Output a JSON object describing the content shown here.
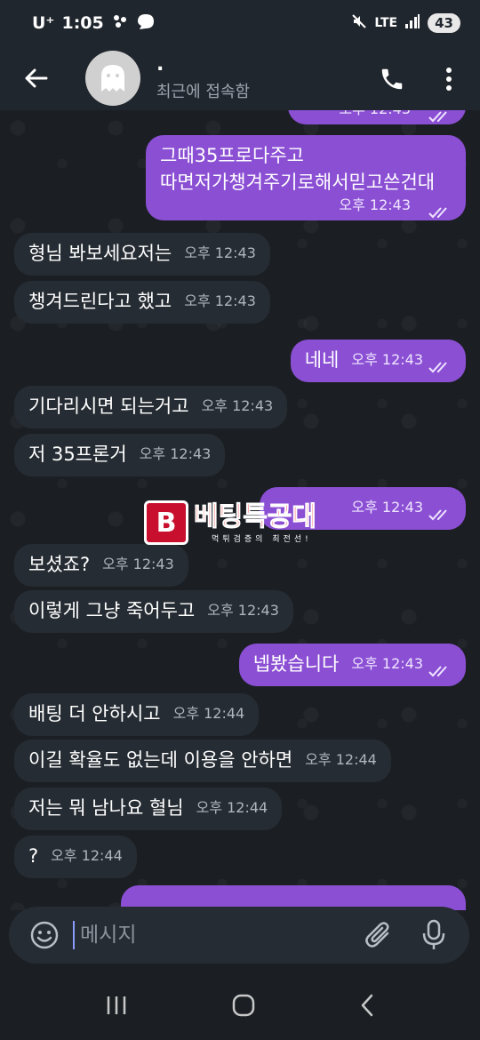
{
  "status_bar": {
    "carrier": "U⁺",
    "time": "1:05",
    "network": "LTE",
    "battery": "43"
  },
  "header": {
    "contact_name": ".",
    "contact_status": "최근에 접속함"
  },
  "messages": [
    {
      "dir": "out",
      "text": "",
      "time": "오후 12:43"
    },
    {
      "dir": "out",
      "text": "그때35프로다주고\n따면저가챙겨주기로해서믿고쓴건대",
      "time": "오후 12:43"
    },
    {
      "dir": "in",
      "text": "형님 봐보세요저는",
      "time": "오후 12:43"
    },
    {
      "dir": "in",
      "text": "챙겨드린다고 했고",
      "time": "오후 12:43"
    },
    {
      "dir": "out",
      "text": "네네",
      "time": "오후 12:43"
    },
    {
      "dir": "in",
      "text": "기다리시면 되는거고",
      "time": "오후 12:43"
    },
    {
      "dir": "in",
      "text": "저 35프론거",
      "time": "오후 12:43"
    },
    {
      "dir": "out",
      "text": "",
      "time": "오후 12:43"
    },
    {
      "dir": "in",
      "text": "보셨죠?",
      "time": "오후 12:43"
    },
    {
      "dir": "in",
      "text": "이렇게 그냥 죽어두고",
      "time": "오후 12:43"
    },
    {
      "dir": "out",
      "text": "넵봤습니다",
      "time": "오후 12:43"
    },
    {
      "dir": "in",
      "text": "배팅 더 안하시고",
      "time": "오후 12:44"
    },
    {
      "dir": "in",
      "text": "이길 확율도 없는데 이용을 안하면",
      "time": "오후 12:44"
    },
    {
      "dir": "in",
      "text": "저는 뭐 남나요 혈님",
      "time": "오후 12:44"
    },
    {
      "dir": "in",
      "text": "?",
      "time": "오후 12:44"
    }
  ],
  "watermark": {
    "badge": "B",
    "title": "베팅특공대",
    "subtitle": "먹튀검증의 최전선!"
  },
  "input": {
    "placeholder": "메시지"
  },
  "colors": {
    "outgoing_bubble": "#8b4fd4",
    "incoming_bubble": "#262c33",
    "background": "#1b1f24",
    "header": "#20262d"
  },
  "icons": [
    "back-arrow-icon",
    "ghost-avatar-icon",
    "phone-icon",
    "more-vert-icon",
    "emoji-icon",
    "attach-icon",
    "mic-icon",
    "recent-apps-icon",
    "home-icon",
    "back-nav-icon",
    "double-check-icon"
  ]
}
